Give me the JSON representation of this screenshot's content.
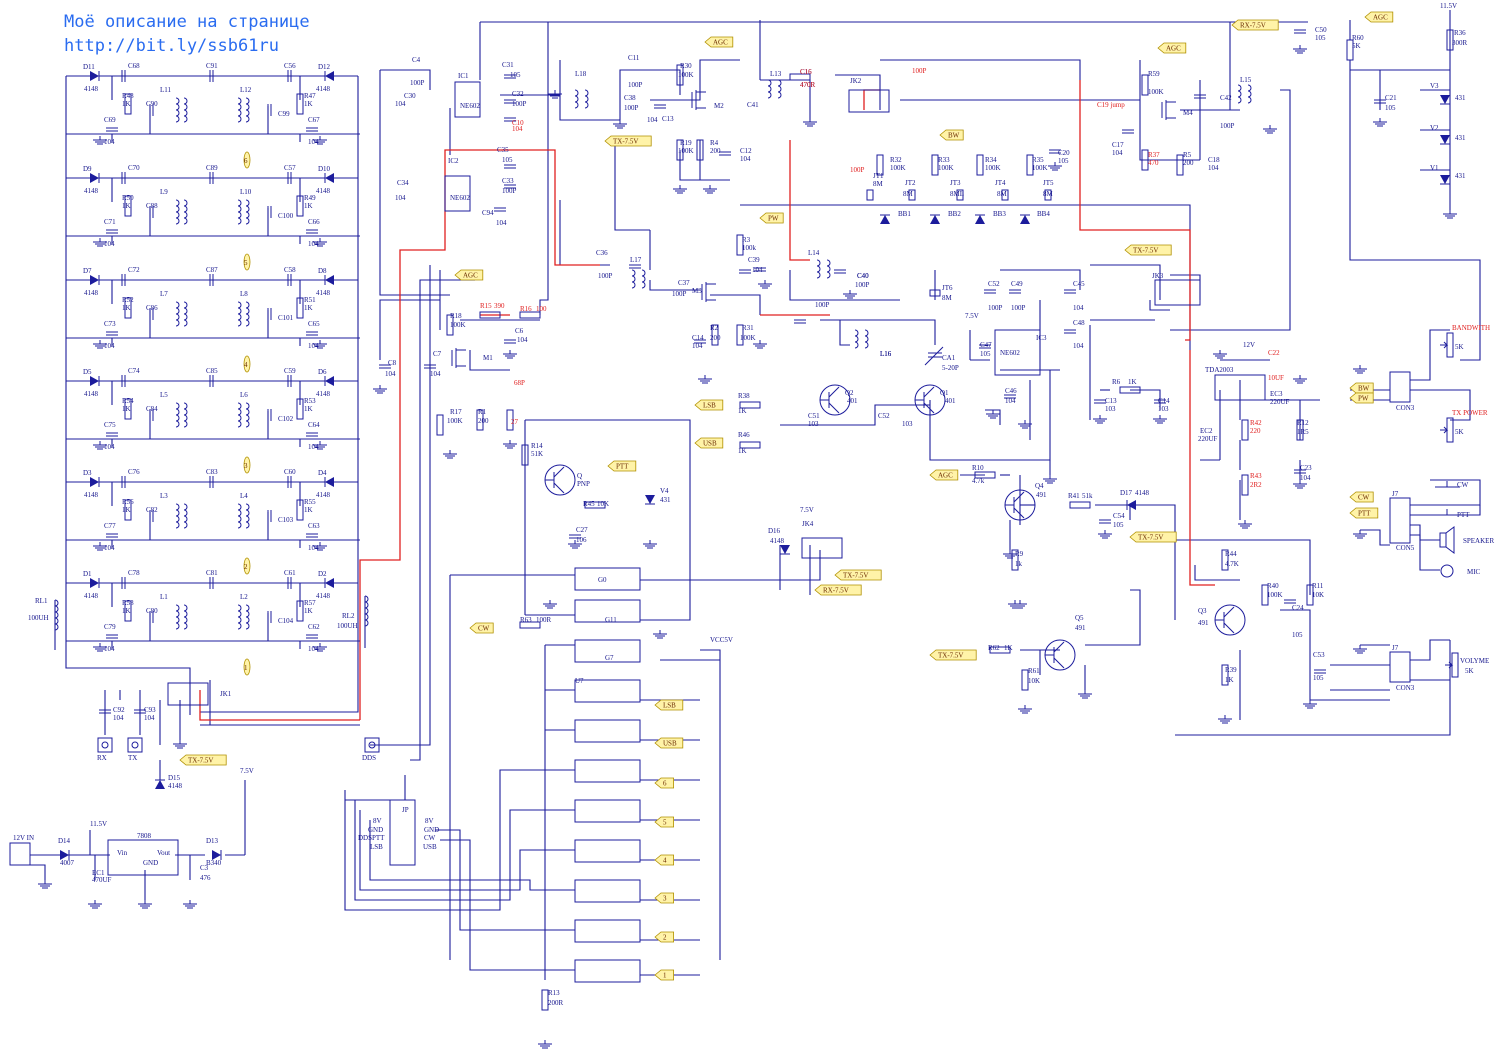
{
  "header": {
    "line1": "Моё описание на странице",
    "line2": "http://bit.ly/ssb61ru"
  },
  "colors": {
    "wire": "#1c1c9c",
    "highlight_wire": "#e02020",
    "net_flag": "#fff3a8",
    "header_text": "#2a6cf0"
  },
  "filters": [
    {
      "din": "D11",
      "dout": "D12",
      "cin": "C68",
      "cmid": "C91",
      "cout": "C56",
      "lin": "L11",
      "lout": "L12",
      "rin": "R48",
      "rout": "R47",
      "cb1": "C90",
      "cb2": "C99",
      "cgin": "C69",
      "cgout": "C67",
      "dval": "4148",
      "rval": "1K",
      "cval": "104",
      "num": "6"
    },
    {
      "din": "D9",
      "dout": "D10",
      "cin": "C70",
      "cmid": "C89",
      "cout": "C57",
      "lin": "L9",
      "lout": "L10",
      "rin": "R50",
      "rout": "R49",
      "cb1": "C88",
      "cb2": "C100",
      "cgin": "C71",
      "cgout": "C66",
      "dval": "4148",
      "rval": "1K",
      "cval": "104",
      "num": "5"
    },
    {
      "din": "D7",
      "dout": "D8",
      "cin": "C72",
      "cmid": "C87",
      "cout": "C58",
      "lin": "L7",
      "lout": "L8",
      "rin": "R52",
      "rout": "R51",
      "cb1": "C86",
      "cb2": "C101",
      "cgin": "C73",
      "cgout": "C65",
      "dval": "4148",
      "rval": "1K",
      "cval": "104",
      "num": "4"
    },
    {
      "din": "D5",
      "dout": "D6",
      "cin": "C74",
      "cmid": "C85",
      "cout": "C59",
      "lin": "L5",
      "lout": "L6",
      "rin": "R54",
      "rout": "R53",
      "cb1": "C84",
      "cb2": "C102",
      "cgin": "C75",
      "cgout": "C64",
      "dval": "4148",
      "rval": "1K",
      "cval": "104",
      "num": "3"
    },
    {
      "din": "D3",
      "dout": "D4",
      "cin": "C76",
      "cmid": "C83",
      "cout": "C60",
      "lin": "L3",
      "lout": "L4",
      "rin": "R56",
      "rout": "R55",
      "cb1": "C82",
      "cb2": "C103",
      "cgin": "C77",
      "cgout": "C63",
      "dval": "4148",
      "rval": "1K",
      "cval": "104",
      "num": "2"
    },
    {
      "din": "D1",
      "dout": "D2",
      "cin": "C78",
      "cmid": "C81",
      "cout": "C61",
      "lin": "L1",
      "lout": "L2",
      "rin": "R58",
      "rout": "R57",
      "cb1": "C80",
      "cb2": "C104",
      "cgin": "C79",
      "cgout": "C62",
      "dval": "4148",
      "rval": "1K",
      "cval": "104",
      "num": "1"
    }
  ],
  "flags": [
    {
      "id": "agc1",
      "text": "AGC"
    },
    {
      "id": "agc2",
      "text": "AGC"
    },
    {
      "id": "agc3",
      "text": "AGC"
    },
    {
      "id": "agc4",
      "text": "AGC"
    },
    {
      "id": "agc5",
      "text": "AGC"
    },
    {
      "id": "rx75",
      "text": "RX-7.5V"
    },
    {
      "id": "tx75a",
      "text": "TX-7.5V"
    },
    {
      "id": "tx75b",
      "text": "TX-7.5V"
    },
    {
      "id": "tx75c",
      "text": "TX-7.5V"
    },
    {
      "id": "tx75d",
      "text": "TX-7.5V"
    },
    {
      "id": "tx75e",
      "text": "TX-7.5V"
    },
    {
      "id": "tx75f",
      "text": "TX-7.5V"
    },
    {
      "id": "rx75b",
      "text": "RX-7.5V"
    },
    {
      "id": "bw1",
      "text": "BW"
    },
    {
      "id": "bw2",
      "text": "BW"
    },
    {
      "id": "pw1",
      "text": "PW"
    },
    {
      "id": "pw2",
      "text": "PW"
    },
    {
      "id": "lsb1",
      "text": "LSB"
    },
    {
      "id": "usb1",
      "text": "USB"
    },
    {
      "id": "lsb2",
      "text": "LSB"
    },
    {
      "id": "usb2",
      "text": "USB"
    },
    {
      "id": "ptt1",
      "text": "PTT"
    },
    {
      "id": "ptt2",
      "text": "PTT"
    },
    {
      "id": "cw1",
      "text": "CW"
    },
    {
      "id": "cw2",
      "text": "CW"
    },
    {
      "id": "n6",
      "text": "6"
    },
    {
      "id": "n5",
      "text": "5"
    },
    {
      "id": "n4",
      "text": "4"
    },
    {
      "id": "n3",
      "text": "3"
    },
    {
      "id": "n2",
      "text": "2"
    },
    {
      "id": "n1",
      "text": "1"
    }
  ],
  "labels": {
    "rl1": "RL1",
    "rl1v": "100UH",
    "rl2": "RL2",
    "rl2v": "100UH",
    "ic1": "IC1",
    "ic2": "IC2",
    "ic3": "IC3",
    "ne602": "NE602",
    "m1": "M1",
    "m2": "M2",
    "m3": "M3",
    "m4": "M4",
    "q1": "Q1",
    "q2": "Q2",
    "q3": "Q3",
    "q4": "Q4",
    "q5": "Q5",
    "q": "Q",
    "pnp": "PNP",
    "v401": "401",
    "v491": "491",
    "jk1": "JK1",
    "jk2": "JK2",
    "jk3": "JK3",
    "jk4": "JK4",
    "tda": "TDA2003",
    "v7808": "7808",
    "vin": "Vin",
    "vout": "Vout",
    "gnd": "GND",
    "v12in": "12V IN",
    "v115": "11.5V",
    "v75": "7.5V",
    "v75b": "7.5V",
    "v12": "12V",
    "v115b": "11.5V",
    "v75c": "7.5V",
    "vcc5": "VCC5V",
    "d14": "D14",
    "d14v": "4007",
    "d13": "D13",
    "d13v": "B340",
    "d15": "D15",
    "d15v": "4148",
    "d16": "D16",
    "d16v": "4148",
    "d17": "D17",
    "d17v": "4148",
    "ec1": "EC1",
    "ec1v": "470UF",
    "ec2": "EC2",
    "ec2v": "220UF",
    "ec3": "EC3",
    "ec3v": "220UF",
    "c3": "C3",
    "c3v": "476",
    "rx": "RX",
    "tx": "TX",
    "dds": "DDS",
    "con1": "CON3",
    "con2": "CON5",
    "con3": "CON3",
    "bandwith": "BANDWITH",
    "txpower": "TX POWER",
    "speaker": "SPEAKER",
    "mic": "MIC",
    "volume": "VOLYME",
    "v5k": "5K",
    "v5k2": "5K",
    "v5k3": "5K",
    "cw": "CW",
    "ptt": "PTT",
    "g0": "G0",
    "g11": "G11",
    "g7": "G7",
    "u7": "U7",
    "opt": "OPTOISO1",
    "r15": "R15",
    "r15v": "390",
    "r16": "R16",
    "r16v": "100",
    "c16": "C16",
    "c16v": "470R",
    "c10": "C10",
    "c10v": "104",
    "c19": "C19 jump",
    "r37": "R37",
    "r37v": "470",
    "r42": "R42",
    "r42v": "220",
    "r43": "R43",
    "r43v": "2R2",
    "c22": "C22",
    "c22v": "10UF",
    "v27": "27",
    "v68p": "68P",
    "v100p": "100P",
    "v100p2": "100P",
    "ca1": "CA1",
    "ca1v": "5-20P",
    "jt6": "JT6",
    "jt6v": "8M",
    "bb1": "BB1",
    "bb2": "BB2",
    "bb3": "BB3",
    "bb4": "BB4",
    "jt1": "JT1",
    "jt2": "JT2",
    "jt3": "JT3",
    "jt4": "JT4",
    "jt5": "JT5",
    "v8m": "8M",
    "v8ml": "8ML",
    "r32": "R32",
    "r33": "R33",
    "r34": "R34",
    "r35": "R35",
    "c20": "C20",
    "c20v": "105",
    "r59": "R59",
    "r59v": "100K",
    "c17": "C17",
    "c17v": "104",
    "r5": "R5",
    "r5v": "200",
    "c18": "C18",
    "c18v": "104",
    "c42": "C42",
    "c42v": "100P",
    "l15": "L15",
    "c50": "C50",
    "c50v": "105",
    "r60": "R60",
    "r60v": "5K",
    "c21": "C21",
    "c21v": "105",
    "r36": "R36",
    "r36v": "300R",
    "v1": "V1",
    "v2": "V2",
    "v3": "V3",
    "v431": "431",
    "c4": "C4",
    "c4v": "100P",
    "c30": "C30",
    "c31": "C31",
    "c32": "C32",
    "c32v": "100P",
    "c34": "C34",
    "c35": "C35",
    "c33": "C33",
    "c94": "C94",
    "c104": "104",
    "c105": "105",
    "l18": "L18",
    "c11": "C11",
    "c11v": "100P",
    "c38": "C38",
    "c38v": "100P",
    "r30": "R30",
    "r30v": "100K",
    "c13": "C13",
    "r19": "R19",
    "r19v": "100K",
    "r4": "R4",
    "r4v": "200",
    "c12": "C12",
    "c12v": "104",
    "l13": "L13",
    "c41": "C41",
    "l17": "L17",
    "c36": "C36",
    "c37": "C37",
    "r3": "R3",
    "r3v": "100k",
    "c39": "C39",
    "l14": "L14",
    "c40": "C40",
    "r2": "R2",
    "r2v": "200",
    "c14": "C14",
    "r31": "R31",
    "r31v": "100K",
    "r18": "R18",
    "r18v": "100K",
    "c6": "C6",
    "c8": "C8",
    "c7": "C7",
    "r17": "R17",
    "r17v": "100K",
    "r1": "R1",
    "r1v": "200",
    "r14": "R14",
    "r14v": "51K",
    "c27": "C27",
    "c27v": "106",
    "r45": "R45",
    "r45v": "10K",
    "v4": "V4",
    "r38": "R38",
    "r46": "R46",
    "v1k": "1K",
    "c51": "C51",
    "c52": "C52",
    "c53": "C53",
    "c103": "103",
    "c49": "C49",
    "c45": "C45",
    "c48": "C48",
    "c47": "C47",
    "c46": "C46",
    "l16": "L16",
    "r6": "R6",
    "c13b": "C13",
    "c14b": "C14",
    "r12": "R12",
    "r12v": "1R5",
    "c23": "C23",
    "r10": "R10",
    "r10v": "4.7k",
    "r9": "R9",
    "r9v": "1k",
    "r41": "R41",
    "r41v": "51k",
    "c54": "C54",
    "r44": "R44",
    "r44v": "4.7K",
    "r40": "R40",
    "r40v": "100K",
    "r11": "R11",
    "r11v": "10K",
    "c24": "C24",
    "r39": "R39",
    "r39v": "1K",
    "r62": "R62",
    "r61": "R61",
    "r61v": "10K",
    "r63": "R63",
    "r63v": "100R",
    "r13": "R13",
    "r13v": "200R",
    "c92": "C92",
    "c93": "C93",
    "j7": "J7",
    "jp": "JP",
    "p8v": "8V",
    "pgnd": "GND",
    "pdds": "DDSPTT",
    "plsb": "LSB",
    "pusb": "USB",
    "pcw": "CW"
  }
}
